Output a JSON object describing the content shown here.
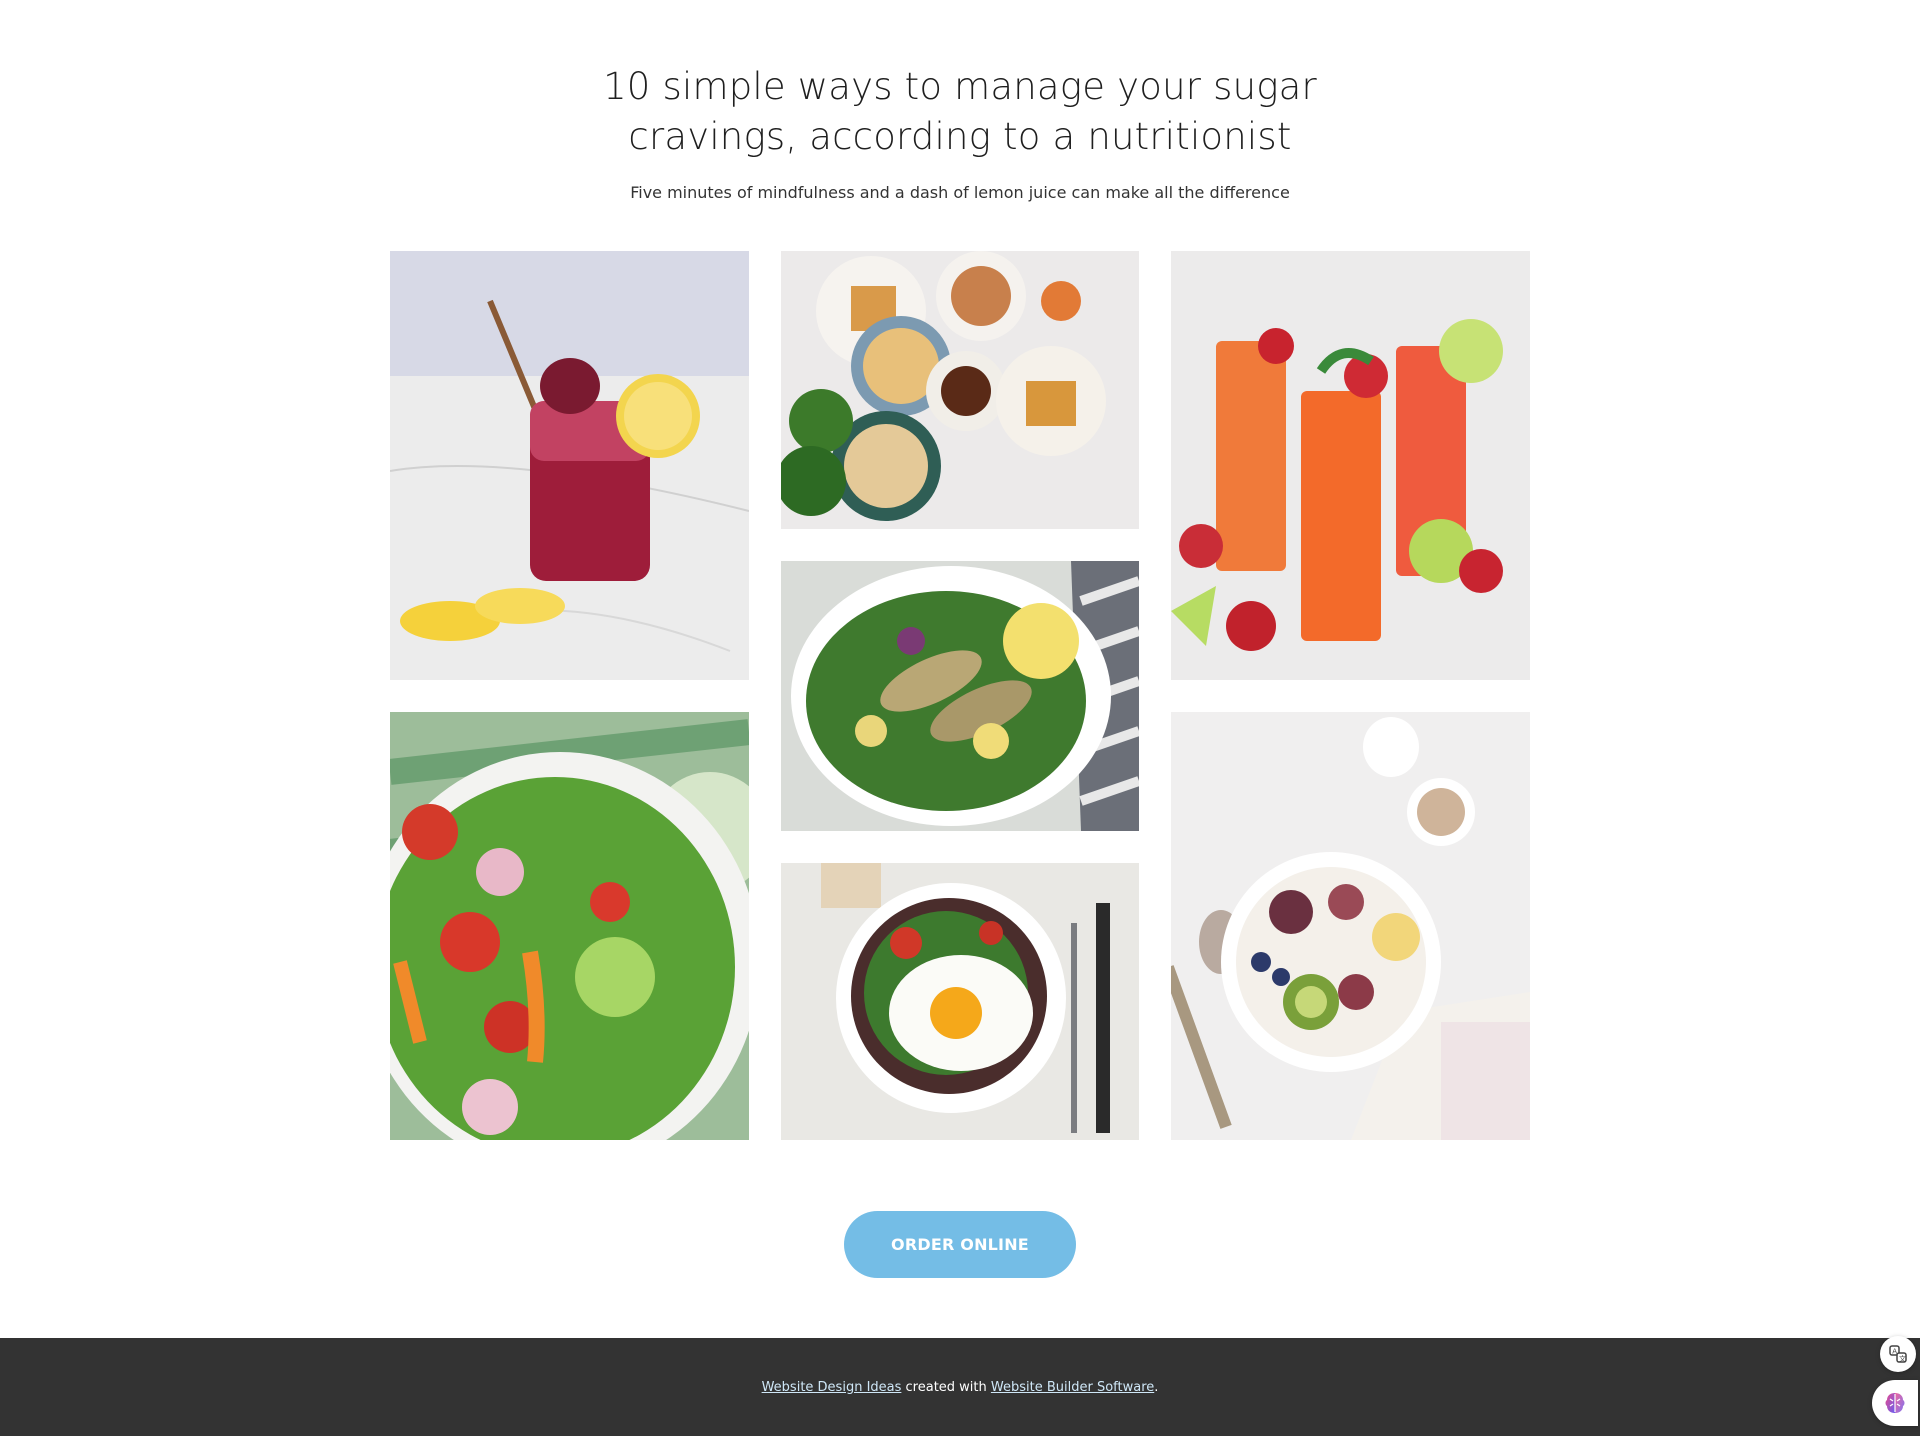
{
  "article": {
    "title_line1": "10 simple ways to manage your sugar",
    "title_line2": "cravings, according to a nutritionist",
    "subtitle": "Five minutes of mindfulness and a dash of lemon juice can make all the difference"
  },
  "gallery": [
    {
      "name": "photo-berry-lemonade-jar",
      "alt": "berry drink in a jar with lemon"
    },
    {
      "name": "photo-breakfast-bowls",
      "alt": "breakfast bowls and waffles"
    },
    {
      "name": "photo-strawberry-drinks",
      "alt": "three strawberry drinks"
    },
    {
      "name": "photo-salmon-salad",
      "alt": "salad with fish and lemon"
    },
    {
      "name": "photo-green-salad",
      "alt": "green salad with tomatoes"
    },
    {
      "name": "photo-fried-egg-salad",
      "alt": "fried egg on salad"
    },
    {
      "name": "photo-fruit-yogurt-bowl",
      "alt": "yogurt bowl with figs and kiwi"
    }
  ],
  "cta": {
    "label": "ORDER ONLINE"
  },
  "footer": {
    "link1": "Website Design Ideas",
    "middle": " created with ",
    "link2": "Website Builder Software",
    "end": "."
  },
  "colors": {
    "button": "#74bde6",
    "footer_bg": "#333333"
  },
  "icons": {
    "float_top": "translate-icon",
    "float_bottom": "brain-icon"
  }
}
